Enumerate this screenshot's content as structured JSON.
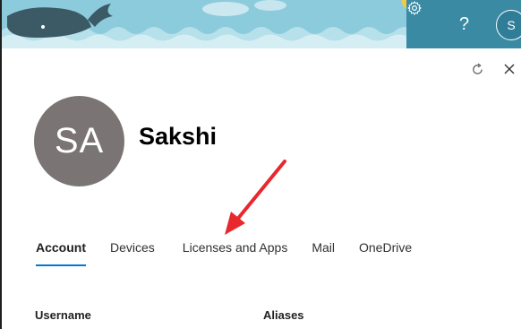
{
  "header": {
    "settings_icon": "gear-icon",
    "help_label": "?",
    "user_initial": "S",
    "accent": "#3a8aa3"
  },
  "panel": {
    "refresh_icon": "refresh-icon",
    "close_icon": "close-icon"
  },
  "profile": {
    "initials": "SA",
    "name": "Sakshi",
    "avatar_color": "#7a7574"
  },
  "tabs": [
    {
      "label": "Account",
      "active": true
    },
    {
      "label": "Devices",
      "active": false
    },
    {
      "label": "Licenses and Apps",
      "active": false
    },
    {
      "label": "Mail",
      "active": false
    },
    {
      "label": "OneDrive",
      "active": false
    }
  ],
  "fields": {
    "username_label": "Username",
    "aliases_label": "Aliases"
  },
  "annotation": {
    "color": "#e8282d",
    "arrow_icon": "red-arrow-annotation"
  }
}
